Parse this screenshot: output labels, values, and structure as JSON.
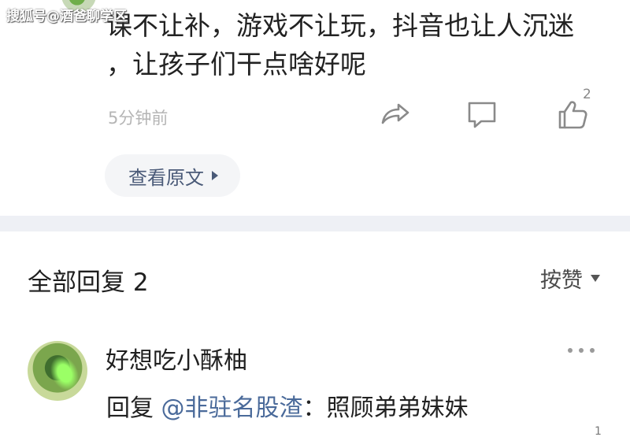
{
  "watermark": "搜狐号@酒爸聊学区",
  "post": {
    "text_line1": "课不让补，游戏不让玩，抖音也让人沉迷",
    "text_line2": "，让孩子们干点啥好呢",
    "time": "5分钟前",
    "like_count": "2",
    "view_original": "查看原文"
  },
  "replies": {
    "title": "全部回复 2",
    "sort_label": "按赞"
  },
  "reply": {
    "author": "好想吃小酥柚",
    "prefix": "回复 ",
    "mention": "@非驻名股渣",
    "content": "：照顾弟弟妹妹",
    "like_count": "1"
  },
  "icons": {
    "share": "share-icon",
    "comment": "comment-icon",
    "like": "thumbs-up-icon",
    "more": "more-dots-icon"
  },
  "colors": {
    "link": "#4a6a9a",
    "muted": "#b5b5b5",
    "divider": "#eef0f5"
  }
}
